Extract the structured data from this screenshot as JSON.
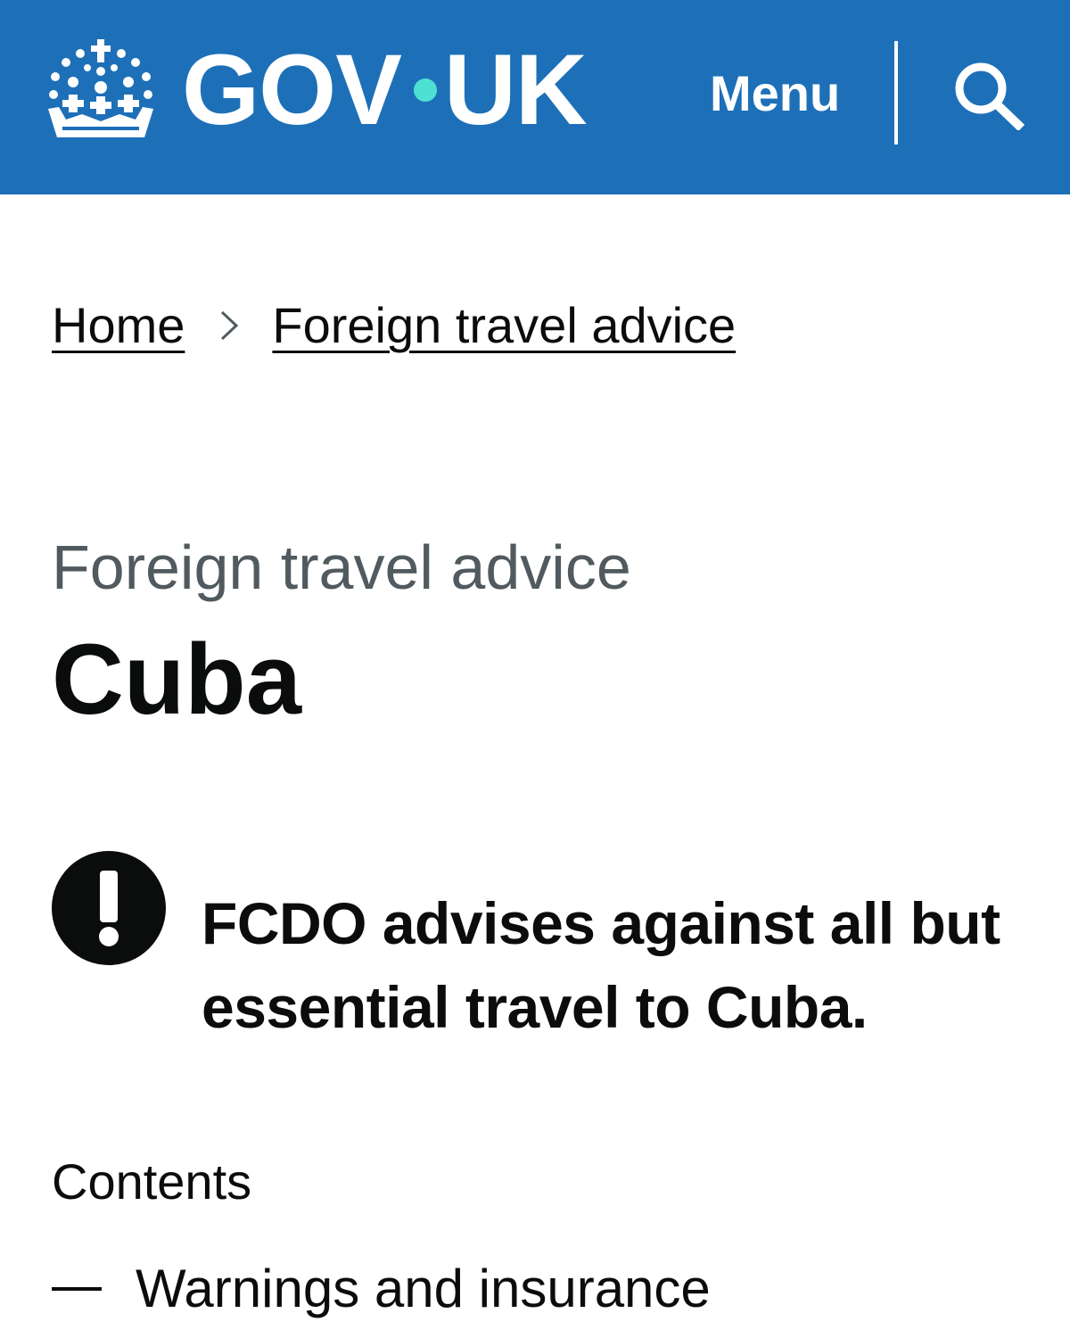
{
  "header": {
    "logo_left": "GOV",
    "logo_right": "UK",
    "menu_label": "Menu",
    "search_icon": "search-icon",
    "crown_icon": "crown-icon",
    "brand_color": "#1d70b8",
    "dot_color": "#4ee0d2"
  },
  "breadcrumbs": {
    "items": [
      {
        "label": "Home"
      },
      {
        "label": "Foreign travel advice"
      }
    ],
    "separator_icon": "chevron-right-icon"
  },
  "page": {
    "caption": "Foreign travel advice",
    "title": "Cuba"
  },
  "warning": {
    "icon": "exclamation-icon",
    "text": "FCDO advises against all but essential travel to Cuba."
  },
  "contents": {
    "title": "Contents",
    "items": [
      {
        "label": "Warnings and insurance"
      }
    ]
  }
}
